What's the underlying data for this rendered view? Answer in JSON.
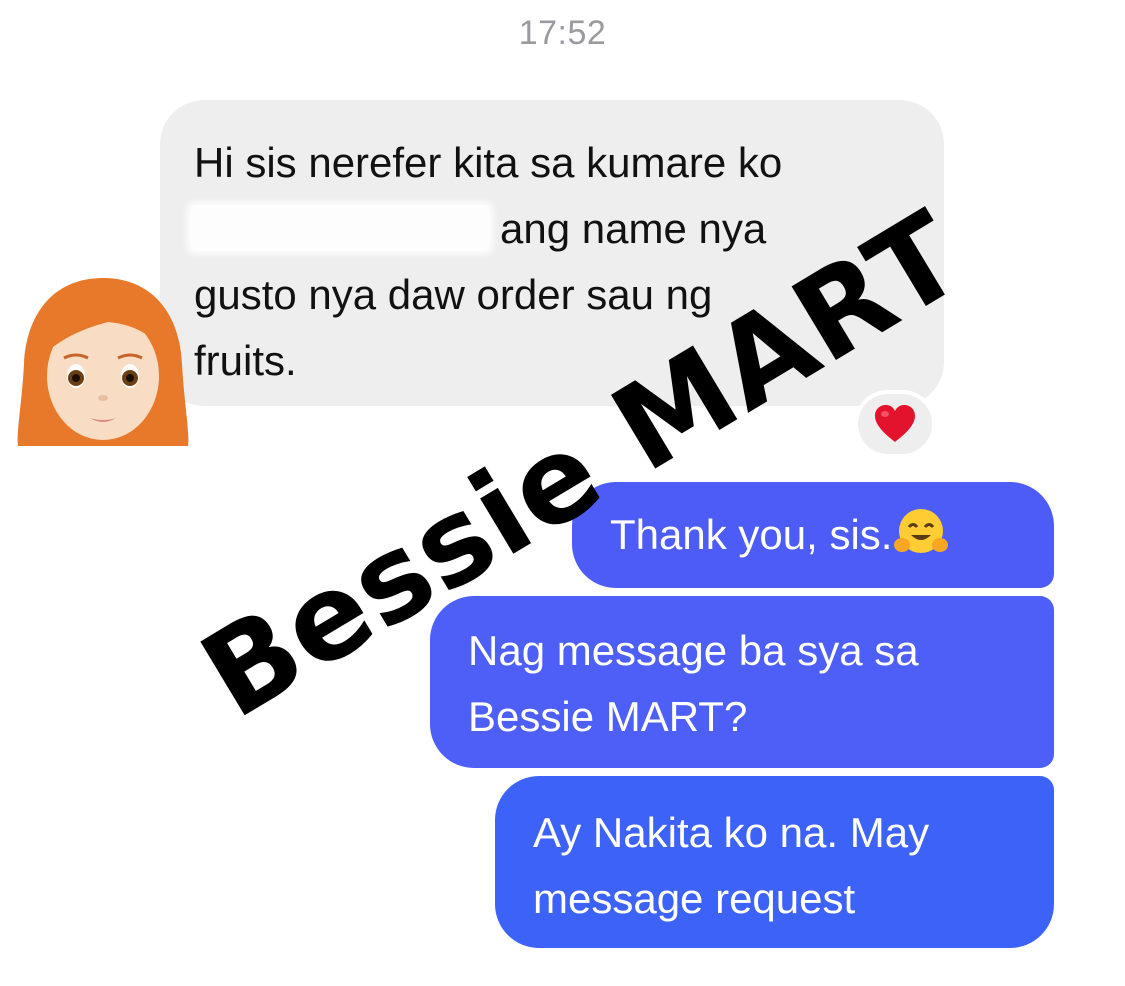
{
  "timestamp": "17:52",
  "incoming_message": {
    "line1": "Hi sis nerefer kita sa kumare ko",
    "line2": "ang name nya",
    "line3": "gusto nya daw order sau ng",
    "line4": "fruits.",
    "reaction_icon": "red-heart-icon",
    "avatar_icon": "woman-red-hair-emoji-icon"
  },
  "outgoing_messages": [
    {
      "line1": "Thank you, sis.",
      "emoji_icon": "hugging-face-emoji-icon"
    },
    {
      "line1": "Nag message ba sya sa",
      "line2": "Bessie MART?"
    },
    {
      "line1": "Ay Nakita ko na. May",
      "line2": "message request"
    }
  ],
  "watermark": "Bessie MART",
  "colors": {
    "incoming_bubble": "#eeeeef",
    "outgoing_bubble": "#4d5cf6",
    "outgoing_bubble_bottom": "#3d62f7",
    "timestamp": "#9a9aa0",
    "heart": "#e3132d",
    "hair": "#e8792a"
  }
}
